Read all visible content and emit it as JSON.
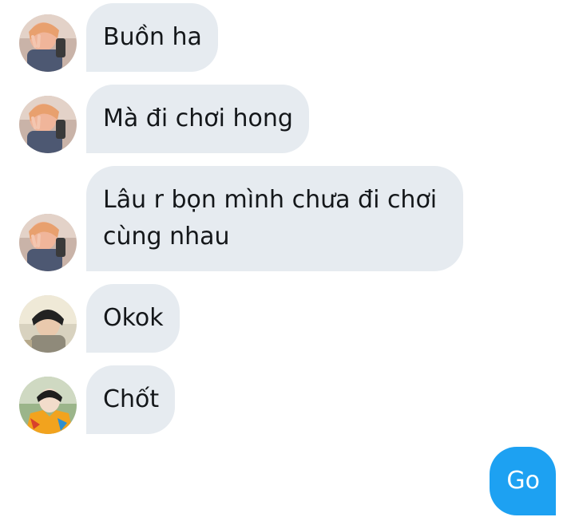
{
  "messages": [
    {
      "sender": "friend-1",
      "avatar_icon": "user-avatar-peace-sign-icon",
      "text": "Buồn ha"
    },
    {
      "sender": "friend-1",
      "avatar_icon": "user-avatar-peace-sign-icon",
      "text": "Mà đi chơi hong"
    },
    {
      "sender": "friend-1",
      "avatar_icon": "user-avatar-peace-sign-icon",
      "text": "Lâu r bọn mình chưa đi chơi cùng nhau"
    },
    {
      "sender": "friend-2",
      "avatar_icon": "user-avatar-dark-hair-icon",
      "text": "Okok"
    },
    {
      "sender": "friend-3",
      "avatar_icon": "user-avatar-colorful-shirt-icon",
      "text": "Chốt"
    },
    {
      "sender": "me",
      "text": "Go"
    }
  ],
  "colors": {
    "incoming_bubble": "#e6ebf0",
    "outgoing_bubble": "#1da1f2",
    "incoming_text": "#14171a",
    "outgoing_text": "#ffffff"
  }
}
